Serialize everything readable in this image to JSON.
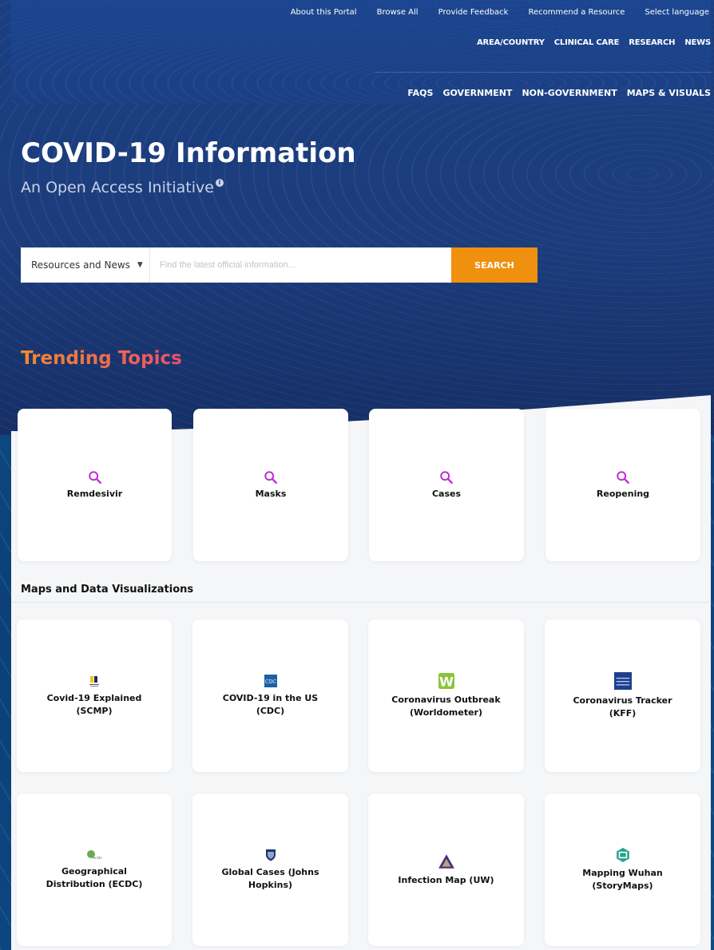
{
  "util_nav": [
    "About this Portal",
    "Browse All",
    "Provide Feedback",
    "Recommend a Resource",
    "Select language"
  ],
  "main_nav": [
    "AREA/COUNTRY",
    "CLINICAL CARE",
    "RESEARCH",
    "NEWS"
  ],
  "sub_nav": [
    "FAQS",
    "GOVERNMENT",
    "NON-GOVERNMENT",
    "MAPS & VISUALS"
  ],
  "hero": {
    "title": "COVID-19 Information",
    "subtitle": "An Open Access Initiative",
    "info_glyph": "i"
  },
  "search": {
    "scope_value": "Resources and News",
    "placeholder": "Find the latest official information...",
    "button_label": "SEARCH"
  },
  "trending": {
    "heading": "Trending Topics",
    "topics": [
      "Remdesivir",
      "Masks",
      "Cases",
      "Reopening"
    ],
    "icon": "magnifier-icon",
    "icon_color": "#c02cd6"
  },
  "maps": {
    "heading": "Maps and Data Visualizations",
    "row1": [
      {
        "line1": "Covid-19 Explained",
        "line2": "(SCMP)",
        "icon": "scmp-logo-icon"
      },
      {
        "line1": "COVID-19 in the US",
        "line2": "(CDC)",
        "icon": "cdc-logo-icon",
        "icon_text": "CDC"
      },
      {
        "line1": "Coronavirus Outbreak",
        "line2": "(Worldometer)",
        "icon": "worldometer-logo-icon",
        "icon_text": "W"
      },
      {
        "line1": "Coronavirus Tracker",
        "line2": "(KFF)",
        "icon": "kff-logo-icon"
      }
    ],
    "row2": [
      {
        "line1": "Geographical",
        "line2": "Distribution (ECDC)",
        "icon": "ecdc-logo-icon"
      },
      {
        "line1": "Global Cases (Johns",
        "line2": "Hopkins)",
        "icon": "johns-hopkins-shield-icon"
      },
      {
        "line1": "Infection Map (UW)",
        "line2": "",
        "icon": "uw-triangle-icon"
      },
      {
        "line1": "Mapping Wuhan",
        "line2": "(StoryMaps)",
        "icon": "storymaps-logo-icon"
      }
    ]
  },
  "colors": {
    "accent_orange": "#f0900f",
    "hero_blue": "#1b3f83",
    "trending_gradient": [
      "#f28a2e",
      "#ec4f6b"
    ]
  }
}
